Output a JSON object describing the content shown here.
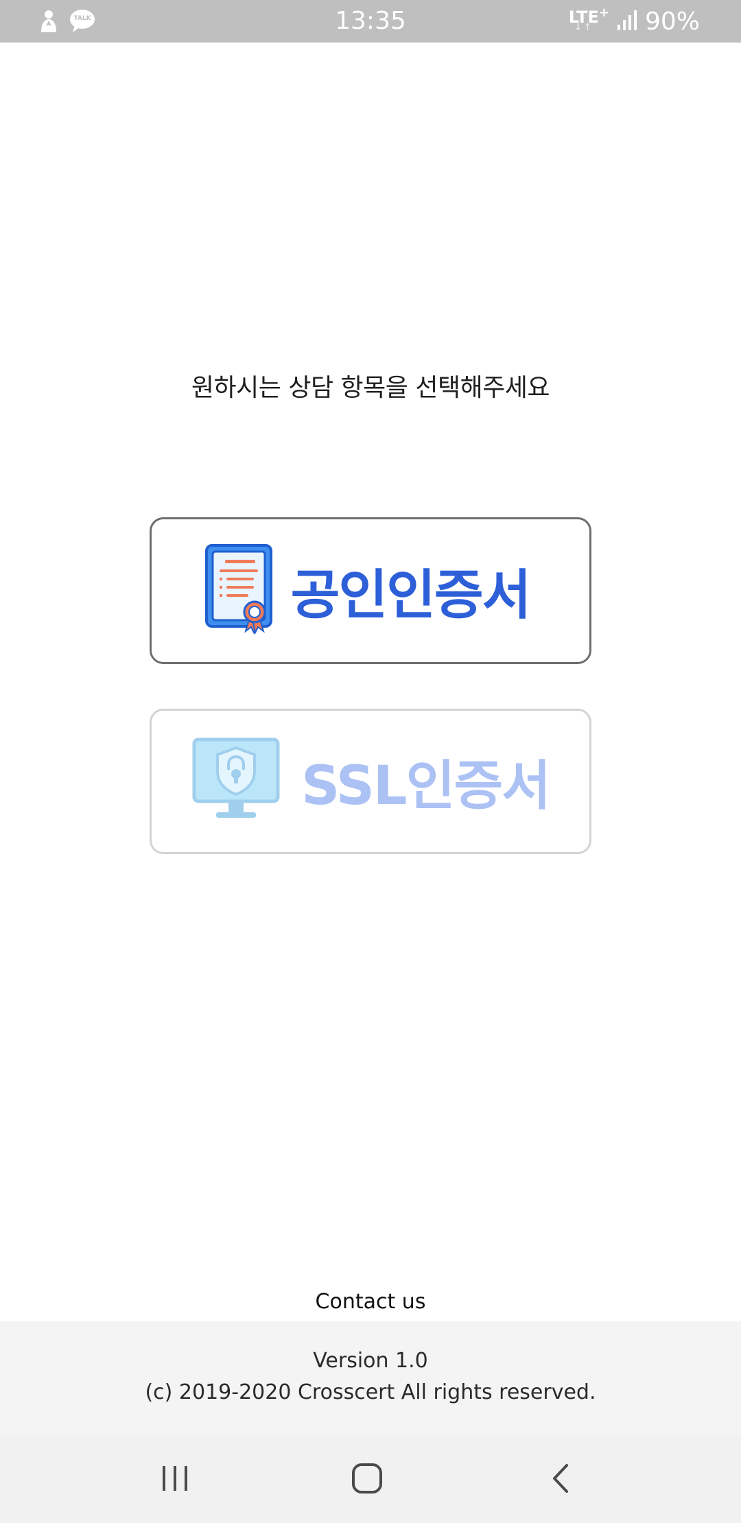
{
  "status_bar": {
    "time": "13:35",
    "network": "LTE",
    "network_plus": "+",
    "network_arrows": "↓↑",
    "battery": "90%",
    "notification_icons": [
      "person-icon",
      "kakaotalk-icon"
    ],
    "talk_badge": "TALK"
  },
  "main": {
    "prompt": "원하시는 상담 항목을 선택해주세요",
    "buttons": [
      {
        "label": "공인인증서",
        "icon": "certificate-icon"
      },
      {
        "label": "SSL인증서",
        "icon": "monitor-lock-icon"
      }
    ]
  },
  "footer": {
    "contact": "Contact us",
    "version": "Version 1.0",
    "copyright": "(c) 2019-2020 Crosscert All rights reserved."
  },
  "nav_bar": {
    "buttons": [
      "recents-icon",
      "home-icon",
      "back-icon"
    ]
  },
  "colors": {
    "status_bar": "#bfbfbf",
    "brand_blue": "#2d5fd8",
    "accent_orange": "#f07b5a",
    "footer_bg": "#f4f4f4"
  }
}
